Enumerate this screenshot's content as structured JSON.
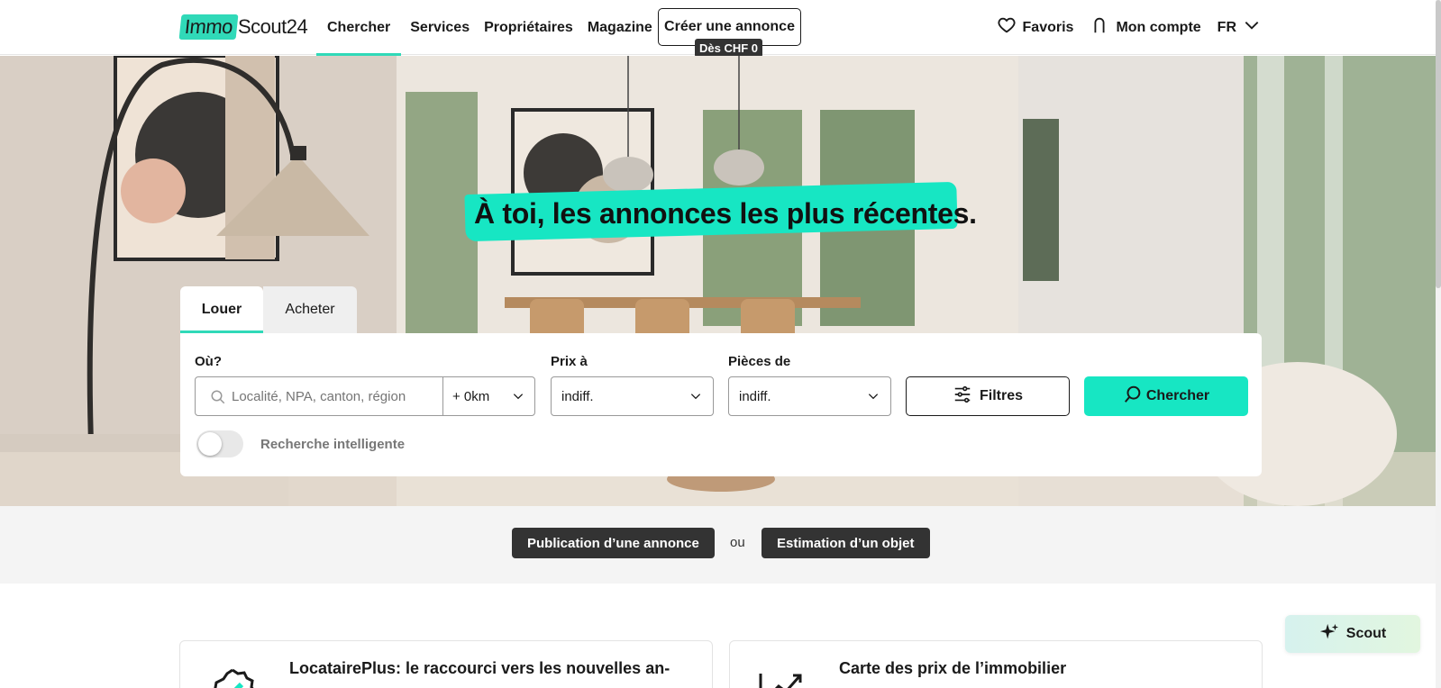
{
  "header": {
    "logo_immo": "Immo",
    "logo_scout": "Scout24",
    "nav": [
      "Chercher",
      "Services",
      "Propriétaires",
      "Magazine"
    ],
    "create_label": "Créer une annonce",
    "create_badge": "Dès CHF 0",
    "favorites_label": "Favoris",
    "account_label": "Mon compte",
    "language": "FR"
  },
  "hero": {
    "title": "À toi, les annonces les plus récentes."
  },
  "search": {
    "tabs": [
      "Louer",
      "Acheter"
    ],
    "active_tab": "Louer",
    "where_label": "Où?",
    "where_placeholder": "Localité, NPA, canton, région",
    "radius_value": "+ 0km",
    "price_label": "Prix à",
    "price_value": "indiff.",
    "rooms_label": "Pièces de",
    "rooms_value": "indiff.",
    "filters_label": "Filtres",
    "search_label": "Chercher",
    "smart_search_label": "Recherche intelligente",
    "smart_search_enabled": false
  },
  "cta": {
    "publish_label": "Publication d’une annonce",
    "or_label": "ou",
    "estimate_label": "Estimation d’un objet"
  },
  "cards": [
    {
      "title": "LocatairePlus: le raccourci vers les nouvelles an-"
    },
    {
      "title": "Carte des prix de l’immobilier"
    }
  ],
  "assistant": {
    "label": "Scout"
  },
  "colors": {
    "accent": "#17e6c3",
    "dark": "#333333"
  }
}
